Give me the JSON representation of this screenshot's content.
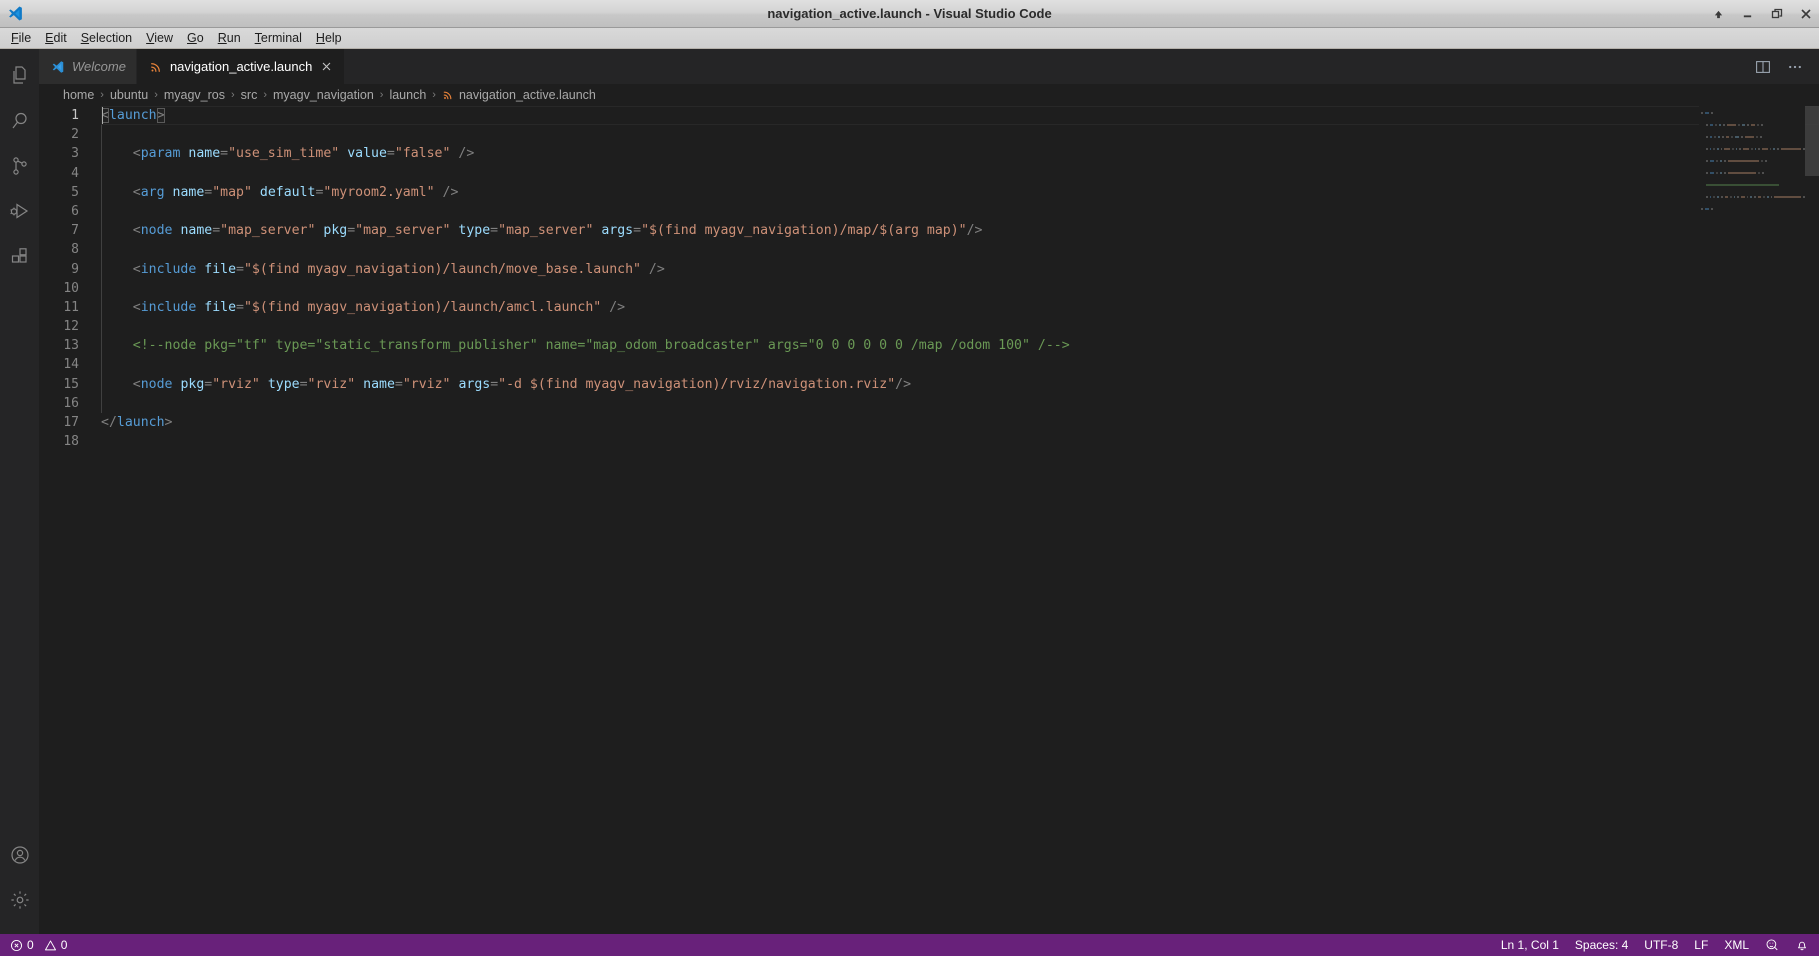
{
  "window": {
    "title": "navigation_active.launch - Visual Studio Code",
    "logo_icon": "vscode-logo-icon",
    "controls": [
      {
        "name": "shade-window-button",
        "icon": "up-arrow-icon",
        "label": "↑"
      },
      {
        "name": "minimize-window-button",
        "icon": "minimize-icon",
        "label": "–"
      },
      {
        "name": "maximize-window-button",
        "icon": "maximize-icon",
        "label": "❐"
      },
      {
        "name": "close-window-button",
        "icon": "close-icon",
        "label": "✕"
      }
    ]
  },
  "menubar": {
    "items": [
      {
        "label": "File",
        "accel": "F"
      },
      {
        "label": "Edit",
        "accel": "E"
      },
      {
        "label": "Selection",
        "accel": "S"
      },
      {
        "label": "View",
        "accel": "V"
      },
      {
        "label": "Go",
        "accel": "G"
      },
      {
        "label": "Run",
        "accel": "R"
      },
      {
        "label": "Terminal",
        "accel": "T"
      },
      {
        "label": "Help",
        "accel": "H"
      }
    ]
  },
  "activitybar": {
    "top_items": [
      {
        "name": "explorer",
        "icon": "files-icon",
        "title": "Explorer"
      },
      {
        "name": "search",
        "icon": "search-icon",
        "title": "Search"
      },
      {
        "name": "source-control",
        "icon": "source-control-icon",
        "title": "Source Control"
      },
      {
        "name": "run-debug",
        "icon": "run-and-debug-icon",
        "title": "Run and Debug"
      },
      {
        "name": "extensions",
        "icon": "extensions-icon",
        "title": "Extensions"
      }
    ],
    "bottom_items": [
      {
        "name": "accounts",
        "icon": "account-icon",
        "title": "Accounts"
      },
      {
        "name": "manage",
        "icon": "gear-icon",
        "title": "Manage"
      }
    ]
  },
  "tabs": [
    {
      "label": "Welcome",
      "icon": "vscode-logo-icon",
      "active": false,
      "italic": true,
      "closable": false
    },
    {
      "label": "navigation_active.launch",
      "icon": "xml-file-icon",
      "active": true,
      "italic": false,
      "closable": true,
      "close_label": "✕"
    }
  ],
  "editor_actions": [
    {
      "name": "split-editor-right-button",
      "icon": "split-editor-icon"
    },
    {
      "name": "more-actions-button",
      "icon": "ellipsis-icon",
      "label": "…"
    }
  ],
  "breadcrumbs": {
    "separator": "›",
    "items": [
      "home",
      "ubuntu",
      "myagv_ros",
      "src",
      "myagv_navigation",
      "launch"
    ],
    "file": {
      "label": "navigation_active.launch",
      "icon": "xml-file-icon"
    }
  },
  "editor": {
    "language": "XML",
    "total_lines": 18,
    "active_line": 1,
    "lines": [
      {
        "n": 1,
        "indent": 0,
        "tokens": [
          {
            "t": "punct",
            "v": "<",
            "bracket": true
          },
          {
            "t": "tag",
            "v": "launch"
          },
          {
            "t": "punct",
            "v": ">",
            "bracket": true
          }
        ]
      },
      {
        "n": 2,
        "indent": 0,
        "tokens": []
      },
      {
        "n": 3,
        "indent": 1,
        "tokens": [
          {
            "t": "punct",
            "v": "<"
          },
          {
            "t": "tag",
            "v": "param"
          },
          {
            "t": "plain",
            "v": " "
          },
          {
            "t": "attr",
            "v": "name"
          },
          {
            "t": "punct",
            "v": "="
          },
          {
            "t": "str",
            "v": "\"use_sim_time\""
          },
          {
            "t": "plain",
            "v": " "
          },
          {
            "t": "attr",
            "v": "value"
          },
          {
            "t": "punct",
            "v": "="
          },
          {
            "t": "str",
            "v": "\"false\""
          },
          {
            "t": "plain",
            "v": " "
          },
          {
            "t": "punct",
            "v": "/>"
          }
        ]
      },
      {
        "n": 4,
        "indent": 1,
        "tokens": []
      },
      {
        "n": 5,
        "indent": 1,
        "tokens": [
          {
            "t": "punct",
            "v": "<"
          },
          {
            "t": "tag",
            "v": "arg"
          },
          {
            "t": "plain",
            "v": " "
          },
          {
            "t": "attr",
            "v": "name"
          },
          {
            "t": "punct",
            "v": "="
          },
          {
            "t": "str",
            "v": "\"map\""
          },
          {
            "t": "plain",
            "v": " "
          },
          {
            "t": "attr",
            "v": "default"
          },
          {
            "t": "punct",
            "v": "="
          },
          {
            "t": "str",
            "v": "\"myroom2.yaml\""
          },
          {
            "t": "plain",
            "v": " "
          },
          {
            "t": "punct",
            "v": "/>"
          }
        ]
      },
      {
        "n": 6,
        "indent": 1,
        "tokens": []
      },
      {
        "n": 7,
        "indent": 1,
        "tokens": [
          {
            "t": "punct",
            "v": "<"
          },
          {
            "t": "tag",
            "v": "node"
          },
          {
            "t": "plain",
            "v": " "
          },
          {
            "t": "attr",
            "v": "name"
          },
          {
            "t": "punct",
            "v": "="
          },
          {
            "t": "str",
            "v": "\"map_server\""
          },
          {
            "t": "plain",
            "v": " "
          },
          {
            "t": "attr",
            "v": "pkg"
          },
          {
            "t": "punct",
            "v": "="
          },
          {
            "t": "str",
            "v": "\"map_server\""
          },
          {
            "t": "plain",
            "v": " "
          },
          {
            "t": "attr",
            "v": "type"
          },
          {
            "t": "punct",
            "v": "="
          },
          {
            "t": "str",
            "v": "\"map_server\""
          },
          {
            "t": "plain",
            "v": " "
          },
          {
            "t": "attr",
            "v": "args"
          },
          {
            "t": "punct",
            "v": "="
          },
          {
            "t": "str",
            "v": "\"$(find myagv_navigation)/map/$(arg map)\""
          },
          {
            "t": "punct",
            "v": "/>"
          }
        ]
      },
      {
        "n": 8,
        "indent": 1,
        "tokens": []
      },
      {
        "n": 9,
        "indent": 1,
        "tokens": [
          {
            "t": "punct",
            "v": "<"
          },
          {
            "t": "tag",
            "v": "include"
          },
          {
            "t": "plain",
            "v": " "
          },
          {
            "t": "attr",
            "v": "file"
          },
          {
            "t": "punct",
            "v": "="
          },
          {
            "t": "str",
            "v": "\"$(find myagv_navigation)/launch/move_base.launch\""
          },
          {
            "t": "plain",
            "v": " "
          },
          {
            "t": "punct",
            "v": "/>"
          }
        ]
      },
      {
        "n": 10,
        "indent": 1,
        "tokens": []
      },
      {
        "n": 11,
        "indent": 1,
        "tokens": [
          {
            "t": "punct",
            "v": "<"
          },
          {
            "t": "tag",
            "v": "include"
          },
          {
            "t": "plain",
            "v": " "
          },
          {
            "t": "attr",
            "v": "file"
          },
          {
            "t": "punct",
            "v": "="
          },
          {
            "t": "str",
            "v": "\"$(find myagv_navigation)/launch/amcl.launch\""
          },
          {
            "t": "plain",
            "v": " "
          },
          {
            "t": "punct",
            "v": "/>"
          }
        ]
      },
      {
        "n": 12,
        "indent": 1,
        "tokens": []
      },
      {
        "n": 13,
        "indent": 1,
        "tokens": [
          {
            "t": "comment",
            "v": "<!--node pkg=\"tf\" type=\"static_transform_publisher\" name=\"map_odom_broadcaster\" args=\"0 0 0 0 0 0 /map /odom 100\" /-->"
          }
        ]
      },
      {
        "n": 14,
        "indent": 1,
        "tokens": []
      },
      {
        "n": 15,
        "indent": 1,
        "tokens": [
          {
            "t": "punct",
            "v": "<"
          },
          {
            "t": "tag",
            "v": "node"
          },
          {
            "t": "plain",
            "v": " "
          },
          {
            "t": "attr",
            "v": "pkg"
          },
          {
            "t": "punct",
            "v": "="
          },
          {
            "t": "str",
            "v": "\"rviz\""
          },
          {
            "t": "plain",
            "v": " "
          },
          {
            "t": "attr",
            "v": "type"
          },
          {
            "t": "punct",
            "v": "="
          },
          {
            "t": "str",
            "v": "\"rviz\""
          },
          {
            "t": "plain",
            "v": " "
          },
          {
            "t": "attr",
            "v": "name"
          },
          {
            "t": "punct",
            "v": "="
          },
          {
            "t": "str",
            "v": "\"rviz\""
          },
          {
            "t": "plain",
            "v": " "
          },
          {
            "t": "attr",
            "v": "args"
          },
          {
            "t": "punct",
            "v": "="
          },
          {
            "t": "str",
            "v": "\"-d $(find myagv_navigation)/rviz/navigation.rviz\""
          },
          {
            "t": "punct",
            "v": "/>"
          }
        ]
      },
      {
        "n": 16,
        "indent": 1,
        "tokens": []
      },
      {
        "n": 17,
        "indent": 0,
        "tokens": [
          {
            "t": "punct",
            "v": "</"
          },
          {
            "t": "tag",
            "v": "launch"
          },
          {
            "t": "punct",
            "v": ">"
          }
        ]
      },
      {
        "n": 18,
        "indent": 0,
        "tokens": []
      }
    ]
  },
  "statusbar": {
    "left": [
      {
        "name": "problems-errors",
        "icon": "error-circle-icon",
        "value": "0"
      },
      {
        "name": "problems-warnings",
        "icon": "warning-triangle-icon",
        "value": "0"
      }
    ],
    "right": [
      {
        "name": "editor-position",
        "label": "Ln 1, Col 1"
      },
      {
        "name": "editor-indentation",
        "label": "Spaces: 4"
      },
      {
        "name": "editor-encoding",
        "label": "UTF-8"
      },
      {
        "name": "editor-eol",
        "label": "LF"
      },
      {
        "name": "editor-language",
        "label": "XML"
      }
    ],
    "right_icons": [
      {
        "name": "feedback-icon",
        "title": "Tweet Feedback"
      },
      {
        "name": "notifications-bell-icon",
        "title": "No Notifications"
      }
    ],
    "background": "#68217a"
  },
  "theme": {
    "editor_bg": "#1e1e1e",
    "sidebar_bg": "#252526",
    "tab_inactive_bg": "#2d2d2d",
    "accent_tag": "#569cd6",
    "accent_attr": "#9cdcfe",
    "accent_string": "#ce9178",
    "accent_comment": "#6a9955",
    "statusbar_bg": "#68217a"
  }
}
